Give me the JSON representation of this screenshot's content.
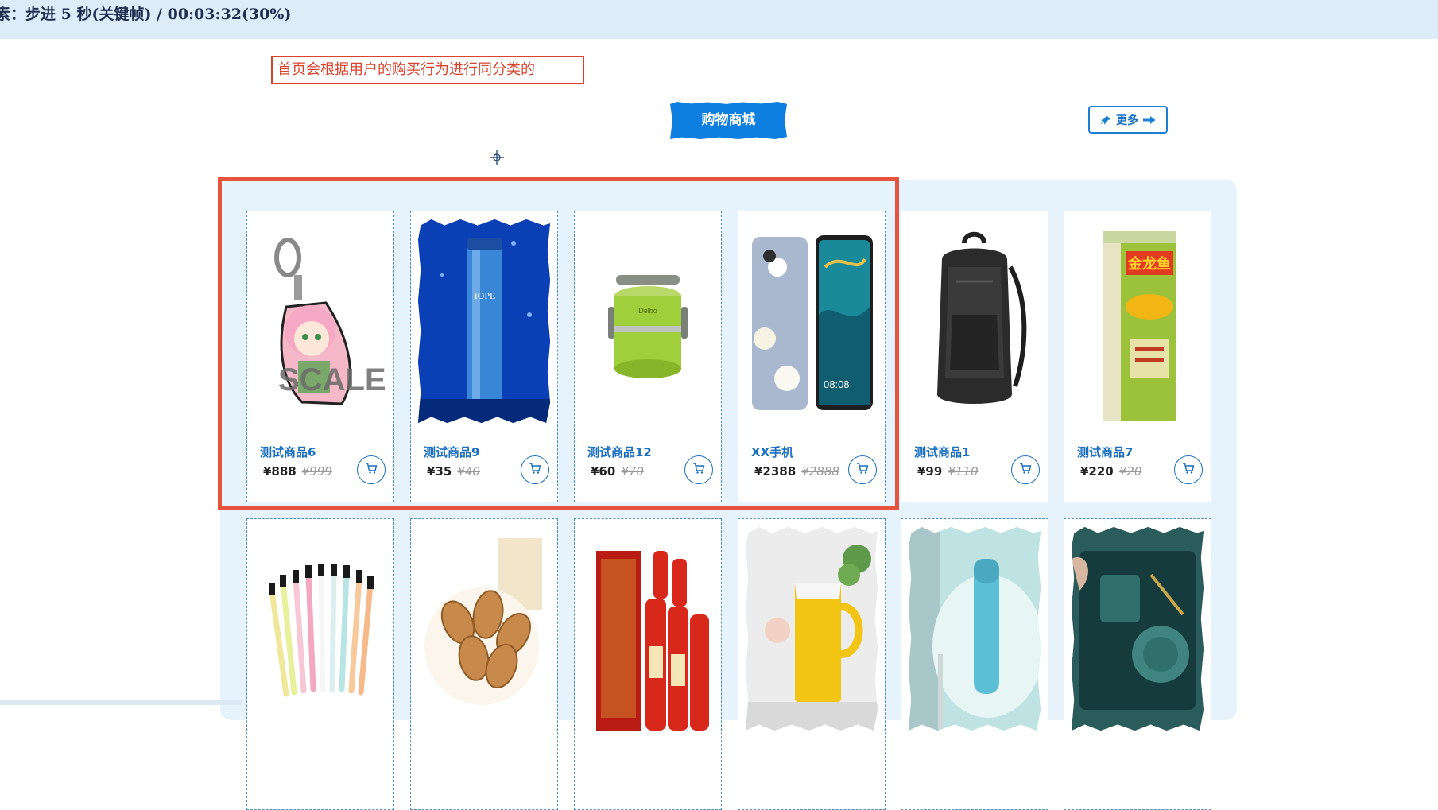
{
  "top_bar": {
    "text": "素：步进 5 秒(关键帧) / 00:03:32(30%)"
  },
  "annotation": {
    "text": "首页会根据用户的购买行为进行同分类的"
  },
  "section": {
    "title": "购物商城",
    "more_label": "更多"
  },
  "currency": "¥",
  "products_row1": [
    {
      "name": "测试商品6",
      "price": "¥888",
      "old_price": "¥999"
    },
    {
      "name": "测试商品9",
      "price": "¥35",
      "old_price": "¥40"
    },
    {
      "name": "测试商品12",
      "price": "¥60",
      "old_price": "¥70"
    },
    {
      "name": "XX手机",
      "price": "¥2388",
      "old_price": "¥2888"
    },
    {
      "name": "测试商品1",
      "price": "¥99",
      "old_price": "¥110"
    },
    {
      "name": "测试商品7",
      "price": "¥220",
      "old_price": "¥20"
    }
  ],
  "image_labels": {
    "keychain": "SCALE",
    "essence": "IOPE",
    "lunchbox": "Delbo",
    "phone_time": "08:08",
    "rice_brand": "金龙鱼"
  },
  "colors": {
    "accent": "#0e7fe0",
    "highlight_border": "#e8533d",
    "panel_bg": "#e6f3fc",
    "name_text": "#1a6fc0"
  }
}
